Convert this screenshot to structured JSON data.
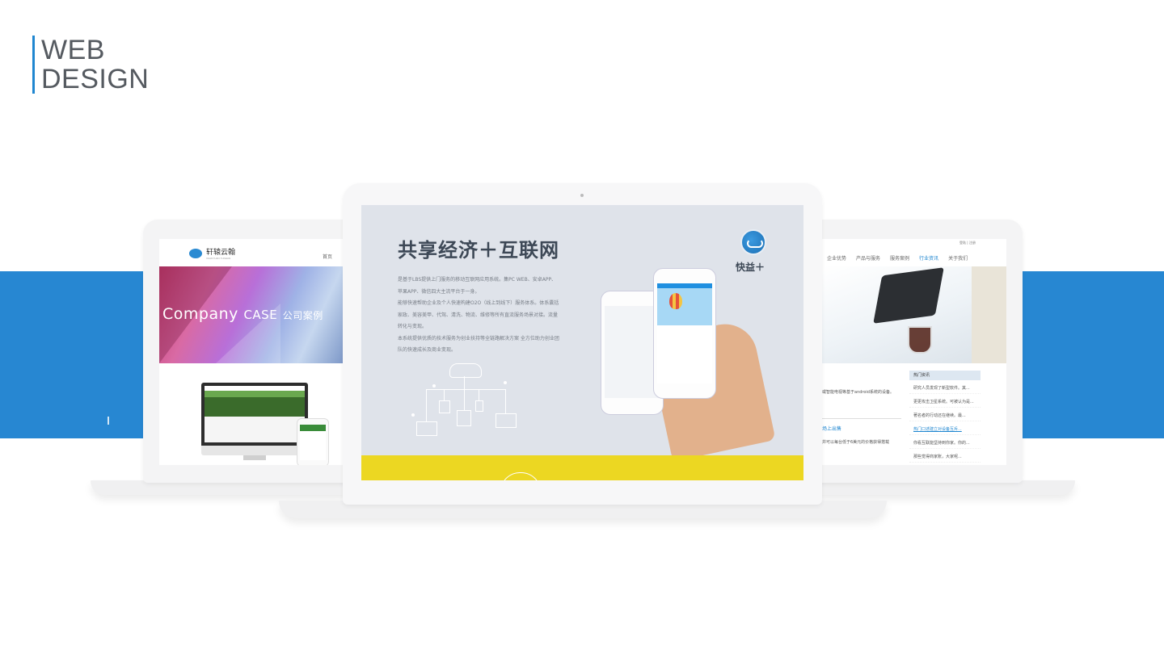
{
  "heading": {
    "line1": "WEB",
    "line2": "DESIGN"
  },
  "left_site": {
    "brand": "轩辕云翰",
    "brand_sub": "XUANYUAN YUNHAN",
    "nav_first": "首页",
    "banner_word": "Company",
    "banner_case": "CASE",
    "banner_cn": "公司案例"
  },
  "center_site": {
    "title": "共享经济＋互联网",
    "paragraphs": [
      "是基于LBS提供上门服务的移动互联网应用系统。集PC WEB、安卓APP、苹果APP、微信四大主流平台于一身。",
      "能够快速帮助企业及个人快速构建O2O（线上到线下）服务体系。体系囊括家政、美容美甲、代驾、清洗、物流、维修等所有直流服务场景对接。流量转化与变现。",
      "本系统提供优质的技术服务为创业扶持等全链路解决方案 全方位助力创业团队的快速成长及商业变现。"
    ],
    "logo_label": "快益＋",
    "colors": {
      "banner_bg": "#dfe3ea",
      "yellow_band": "#ecd722",
      "brand_blue": "#1f86d0"
    }
  },
  "right_site": {
    "top_links": "登陆 | 注册",
    "nav": [
      "企业优势",
      "产品与服务",
      "服务案例",
      "行业资讯",
      "关于我们"
    ],
    "nav_active_index": 3,
    "left_text_1": "或智能电视等基于android系统的设备。",
    "link_text": "场上出售",
    "left_text_2": "并可以每台低于6美元的价格获得搭载",
    "sidebar_title": "热门资讯",
    "sidebar_items": [
      "研究人员发现了新型软件。其...",
      "更更攻击卫星系统。可被认为是...",
      "著名者的行动还在继续。最...",
      "热门口述建立对设备互斥...",
      "你看互联能坚持到你家。你的...",
      "那些觉得商家账，大家呢..."
    ],
    "sidebar_link_index": 3
  }
}
